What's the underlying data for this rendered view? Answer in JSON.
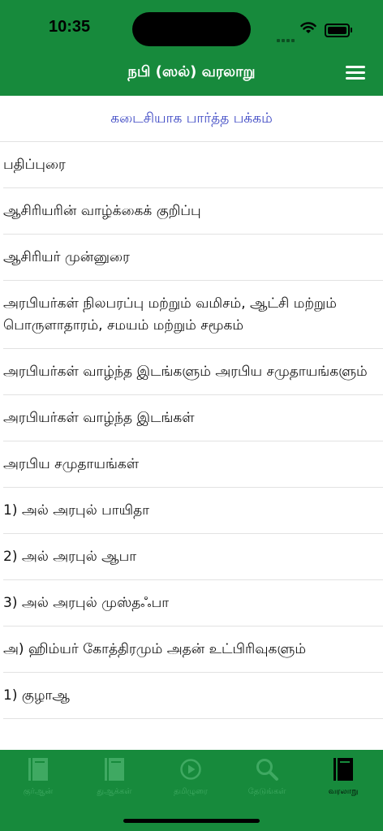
{
  "status": {
    "time": "10:35"
  },
  "header": {
    "title": "நபி (ஸல்) வரலாறு",
    "menu_icon": "hamburger-menu-icon"
  },
  "last_viewed": "கடைசியாக பார்த்த பக்கம்",
  "rows": [
    "பதிப்புரை",
    "ஆசிரியரின் வாழ்க்கைக் குறிப்பு",
    "ஆசிரியர் முன்னுரை",
    "அரபியர்கள் நிலபரப்பு மற்றும் வமிசம், ஆட்சி மற்றும் பொருளாதாரம், சமயம் மற்றும் சமூகம்",
    "அரபியர்கள் வாழ்ந்த இடங்களும் அரபிய சமுதாயங்களும்",
    "அரபியர்கள் வாழ்ந்த இடங்கள்",
    "அரபிய சமுதாயங்கள்",
    "1) அல் அரபுல் பாயிதா",
    "2) அல் அரபுல் ஆபா",
    "3) அல் அரபுல் முஸ்தஃபா",
    "அ) ஹிம்யர் கோத்திரமும் அதன் உட்பிரிவுகளும்",
    "1) குழாஆ"
  ],
  "tabs": [
    {
      "label": "குர்ஆன்",
      "icon": "book-icon",
      "active": false
    },
    {
      "label": "துஆக்கள்",
      "icon": "book-icon",
      "active": false
    },
    {
      "label": "தமிழுரை",
      "icon": "play-circle-icon",
      "active": false
    },
    {
      "label": "தேடுங்கள்",
      "icon": "search-icon",
      "active": false
    },
    {
      "label": "வரலாறு",
      "icon": "book-icon",
      "active": true
    }
  ],
  "colors": {
    "brand": "#178a3c",
    "link": "#3d48c4",
    "tab_inactive": "#3fa962",
    "tab_active": "#000000"
  }
}
